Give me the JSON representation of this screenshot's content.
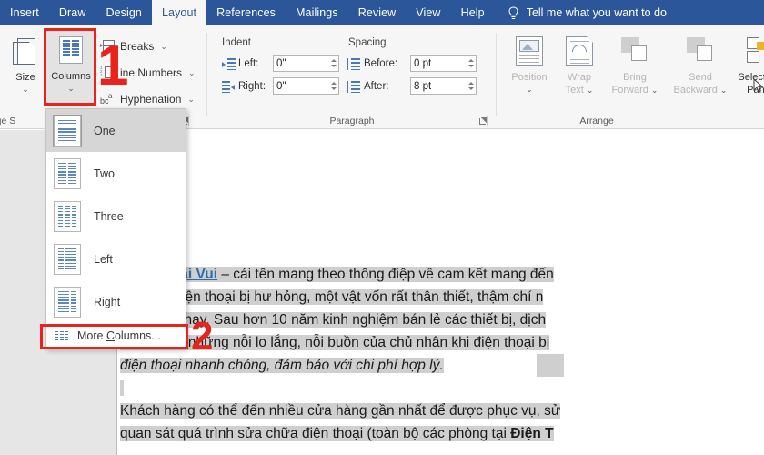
{
  "tabs": [
    {
      "label": "Insert",
      "active": false
    },
    {
      "label": "Draw",
      "active": false
    },
    {
      "label": "Design",
      "active": false
    },
    {
      "label": "Layout",
      "active": true
    },
    {
      "label": "References",
      "active": false
    },
    {
      "label": "Mailings",
      "active": false
    },
    {
      "label": "Review",
      "active": false
    },
    {
      "label": "View",
      "active": false
    },
    {
      "label": "Help",
      "active": false
    }
  ],
  "tellme": {
    "label": "Tell me what you want to do",
    "icon": "lightbulb-icon"
  },
  "ribbon": {
    "page_setup": {
      "group_label": "Page S",
      "size_button": {
        "label": "Size",
        "caret": "⌄",
        "icon": "page-size-icon"
      },
      "columns_button": {
        "label": "Columns",
        "caret": "⌄",
        "icon": "columns-icon"
      },
      "breaks_button": {
        "label": "Breaks",
        "caret": "⌄",
        "icon": "breaks-icon"
      },
      "line_numbers_button": {
        "label": "ine Numbers",
        "caret": "⌄",
        "icon": "line-numbers-icon"
      },
      "hyphenation_button": {
        "label": "Hyphenation",
        "caret": "⌄",
        "icon": "hyphenation-icon"
      }
    },
    "paragraph": {
      "group_label": "Paragraph",
      "indent_head": "Indent",
      "spacing_head": "Spacing",
      "left_label": "Left:",
      "left_value": "0\"",
      "right_label": "Right:",
      "right_value": "0\"",
      "before_label": "Before:",
      "before_value": "0 pt",
      "after_label": "After:",
      "after_value": "8 pt"
    },
    "arrange": {
      "group_label": "Arrange",
      "position_button": {
        "label": "Position",
        "caret": "⌄",
        "icon": "position-icon"
      },
      "wrap_text_button": {
        "label_1": "Wrap",
        "label_2": "Text",
        "caret": "⌄",
        "icon": "wrap-text-icon"
      },
      "bring_forward_button": {
        "label_1": "Bring",
        "label_2": "Forward",
        "caret": "⌄",
        "icon": "bring-forward-icon"
      },
      "send_backward_button": {
        "label_1": "Send",
        "label_2": "Backward",
        "caret": "⌄",
        "icon": "send-backward-icon"
      },
      "selection_pane_button": {
        "label_1": "Selection",
        "label_2": "Pane",
        "icon": "selection-pane-icon"
      }
    }
  },
  "columns_menu": {
    "items": [
      {
        "label": "One",
        "cols": 1,
        "selected": true
      },
      {
        "label": "Two",
        "cols": 2,
        "selected": false
      },
      {
        "label": "Three",
        "cols": 3,
        "selected": false
      },
      {
        "label": "Left",
        "cols": 2,
        "selected": false
      },
      {
        "label": "Right",
        "cols": 2,
        "selected": false
      }
    ],
    "more": {
      "label_pre": "More ",
      "label_accel": "C",
      "label_post": "olumns...",
      "icon": "columns-icon"
    }
  },
  "annotations": [
    {
      "name": "step-1",
      "number": "1",
      "target": "columns-button"
    },
    {
      "name": "step-2",
      "number": "2",
      "target": "more-columns-menu-item"
    }
  ],
  "colors": {
    "ribbon_blue": "#2b579a",
    "annotation_red": "#e8231c",
    "selection_gray": "#cfcfcf",
    "link_blue": "#2f6ca8"
  },
  "document": {
    "paragraph_1": {
      "link_text": "Điện Thoại Vui",
      "lines": [
        " – cái tên mang theo thông điệp về cam kết mang đến",
        "hàng có điện thoại bị hư hỏng, một vật vốn rất thân thiết, thậm chí n",
        "trong thời nay. Sau hơn 10 năm kinh nghiệm bán lẻ các thiết bị, dịch",
        "hiểu được những nỗi lo lắng, nỗi buồn của chủ nhân khi điện thoại bị"
      ],
      "italic_line": "điện thoại nhanh chóng, đảm bảo với chi phí hợp lý."
    },
    "paragraph_2": {
      "line_1": "Khách hàng có thể đến nhiều cửa hàng gần nhất để được phục vụ, sử",
      "line_2_pre": "quan sát quá trình sửa chữa điện thoại (toàn bộ các phòng tại ",
      "line_2_bold": "Điện T"
    }
  }
}
